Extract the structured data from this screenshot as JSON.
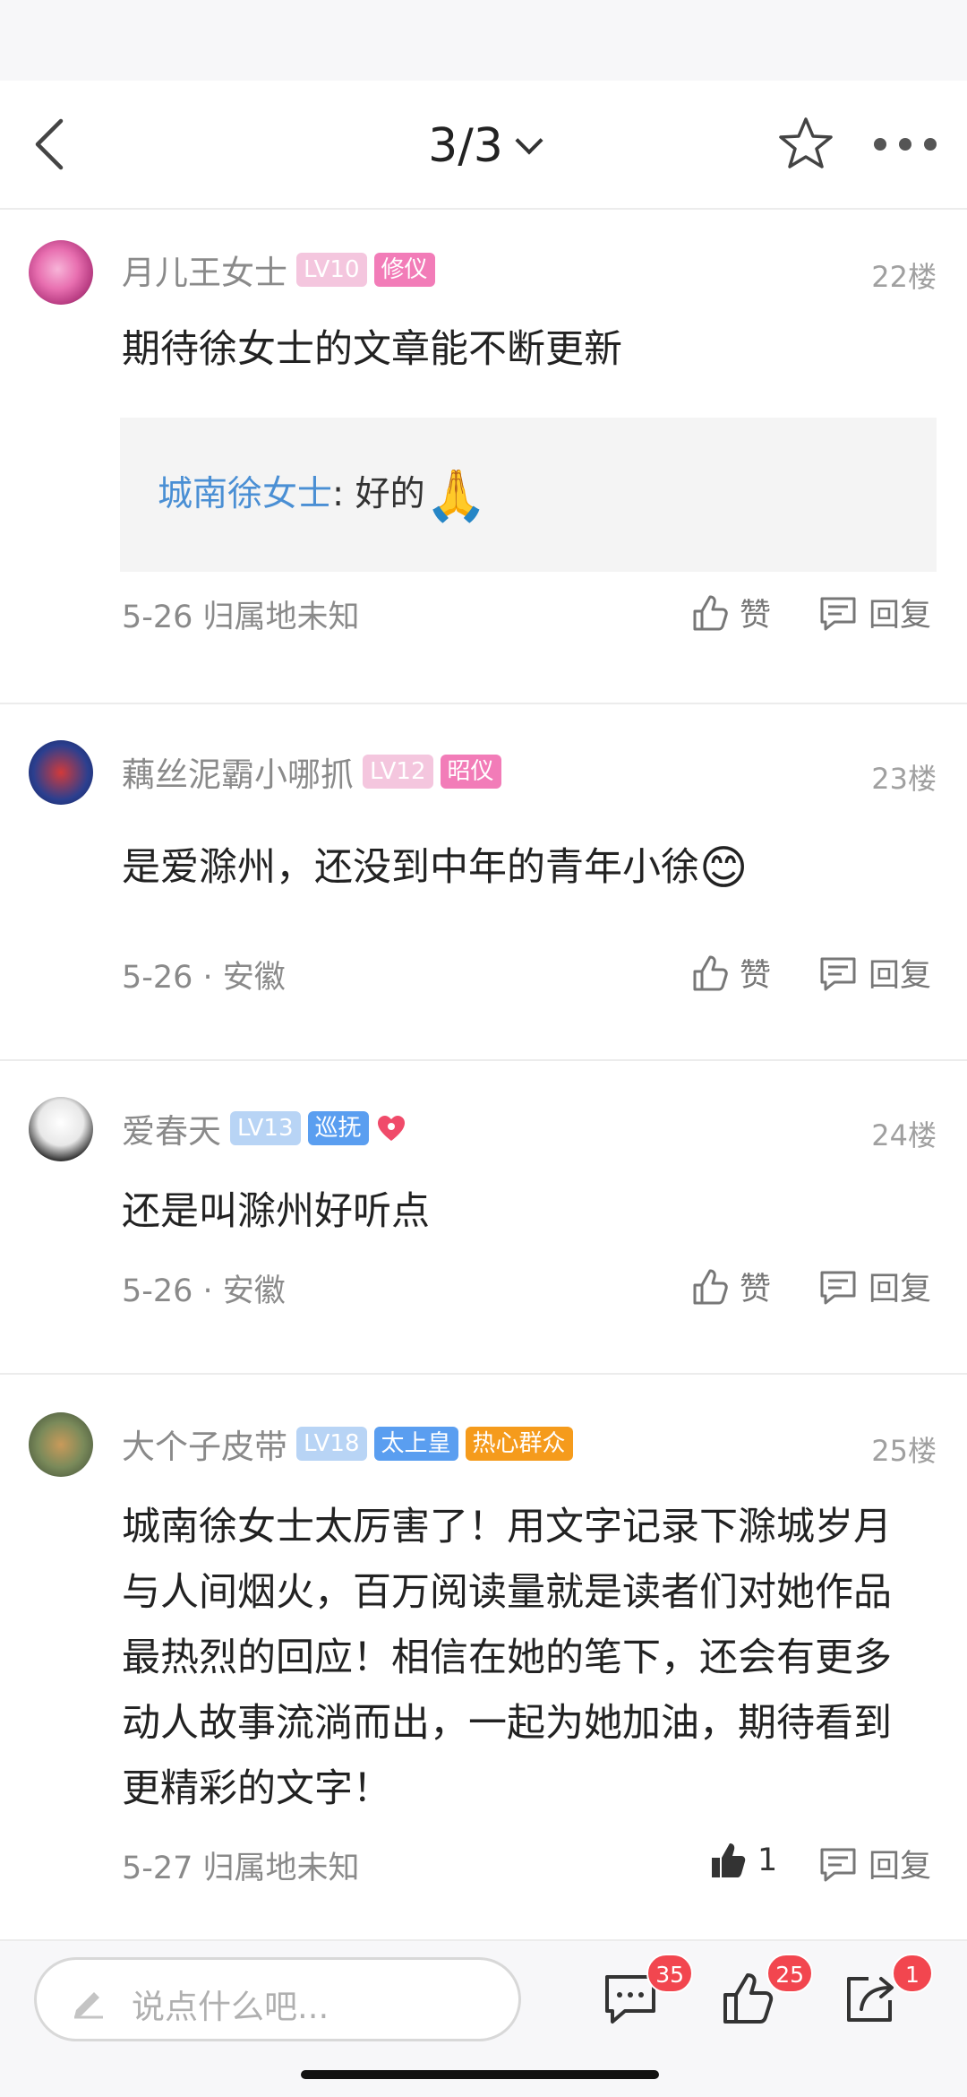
{
  "nav": {
    "title": "3/3"
  },
  "comments": [
    {
      "user": "月儿王女士",
      "level": "LV10",
      "title": "修仪",
      "floor": "22楼",
      "text": "期待徐女士的文章能不断更新",
      "reply": {
        "name": "城南徐女士",
        "sep": ":",
        "text": "好的",
        "emoji": "🙏"
      },
      "meta": "5-26 归属地未知",
      "like": "赞",
      "reply_label": "回复"
    },
    {
      "user": "藕丝泥霸小哪抓",
      "level": "LV12",
      "title": "昭仪",
      "floor": "23楼",
      "text": "是爱滁州，还没到中年的青年小徐",
      "emoji": "😊",
      "meta": "5-26 · 安徽",
      "like": "赞",
      "reply_label": "回复"
    },
    {
      "user": "爱春天",
      "level": "LV13",
      "title": "巡抚",
      "floor": "24楼",
      "text": "还是叫滁州好听点",
      "meta": "5-26 · 安徽",
      "like": "赞",
      "reply_label": "回复"
    },
    {
      "user": "大个子皮带",
      "level": "LV18",
      "title": "太上皇",
      "title2": "热心群众",
      "floor": "25楼",
      "text": "城南徐女士太厉害了！用文字记录下滁城岁月与人间烟火，百万阅读量就是读者们对她作品最热烈的回应！相信在她的笔下，还会有更多动人故事流淌而出，一起为她加油，期待看到更精彩的文字！",
      "meta": "5-27 归属地未知",
      "like": "1",
      "reply_label": "回复"
    }
  ],
  "bottom": {
    "placeholder": "说点什么吧...",
    "comment_count": "35",
    "like_count": "25",
    "share_count": "1"
  },
  "colors": {
    "accent_blue": "#4a8fd4",
    "badge_red": "#f2464f",
    "title_pink": "#f27cb8",
    "title_blue": "#5a9ef0",
    "title_orange": "#f59b1c"
  }
}
